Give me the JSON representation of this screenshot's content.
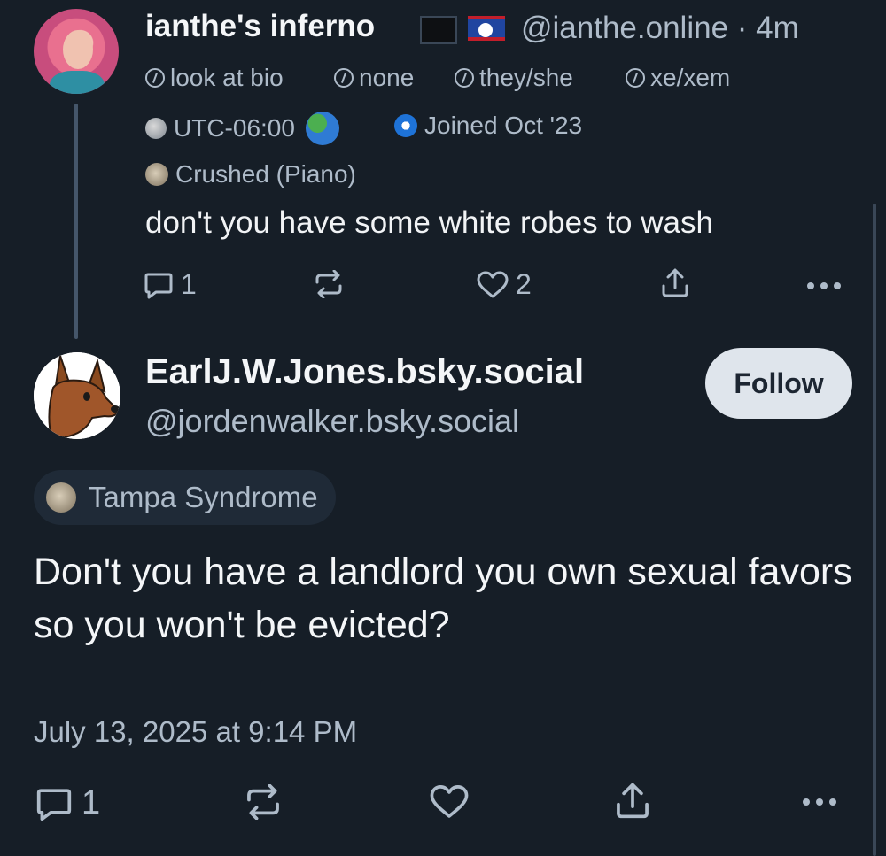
{
  "parent_post": {
    "display_name": "ianthe's inferno",
    "handle": "@ianthe.online",
    "time_ago": "· 4m",
    "pronoun_tags": [
      "look at bio",
      "none",
      "they/she",
      "xe/xem"
    ],
    "timezone": "UTC-06:00",
    "joined": "Joined Oct '23",
    "badge": "Crushed (Piano)",
    "text": "don't you have some white robes to wash",
    "reply_count": "1",
    "like_count": "2"
  },
  "main_post": {
    "display_name": "EarlJ.W.Jones.bsky.social",
    "handle": "@jordenwalker.bsky.social",
    "follow_label": "Follow",
    "badge": "Tampa Syndrome",
    "text": "Don't you have a landlord you own sexual favors so you won't be evicted?",
    "timestamp": "July 13, 2025 at 9:14 PM",
    "reply_count": "1"
  },
  "icons": [
    "reply-icon",
    "repost-icon",
    "like-icon",
    "share-icon",
    "more-icon"
  ],
  "colors": {
    "background": "#161e27",
    "text": "#f1f3f5",
    "muted": "#aebbc9",
    "follow_bg": "#dfe5ec"
  }
}
